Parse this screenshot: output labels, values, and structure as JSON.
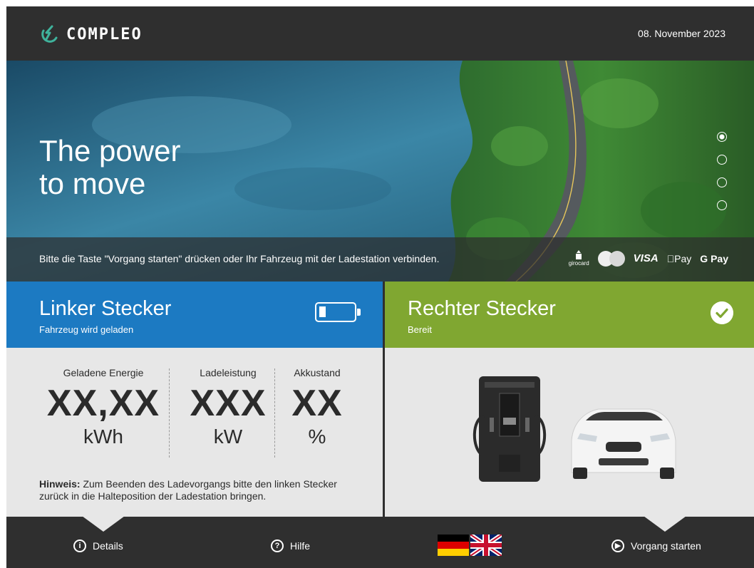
{
  "header": {
    "brand": "COMPLEO",
    "date": "08. November 2023"
  },
  "hero": {
    "title_line1": "The power",
    "title_line2": "to move",
    "slide_count": 4,
    "active_slide": 1,
    "notice": "Bitte die Taste \"Vorgang starten\" drücken oder Ihr Fahrzeug mit der Ladestation verbinden.",
    "payments": {
      "girocard": "girocard",
      "mastercard_label": "mastercard",
      "visa": "VISA",
      "apple_pay": "Pay",
      "google_pay": "G Pay"
    }
  },
  "left_connector": {
    "title": "Linker Stecker",
    "status": "Fahrzeug wird geladen",
    "color": "#1c7ac2",
    "metrics": [
      {
        "label": "Geladene Energie",
        "value": "XX,XX",
        "unit": "kWh"
      },
      {
        "label": "Ladeleistung",
        "value": "XXX",
        "unit": "kW"
      },
      {
        "label": "Akkustand",
        "value": "XX",
        "unit": "%"
      }
    ],
    "hint_prefix": "Hinweis:",
    "hint_text": " Zum Beenden des Ladevorgangs bitte den linken Stecker zurück in die Halteposition der Ladestation bringen."
  },
  "right_connector": {
    "title": "Rechter Stecker",
    "status": "Bereit",
    "color": "#80a731"
  },
  "footer": {
    "details": "Details",
    "help": "Hilfe",
    "start": "Vorgang starten",
    "languages": [
      "de",
      "en"
    ]
  }
}
